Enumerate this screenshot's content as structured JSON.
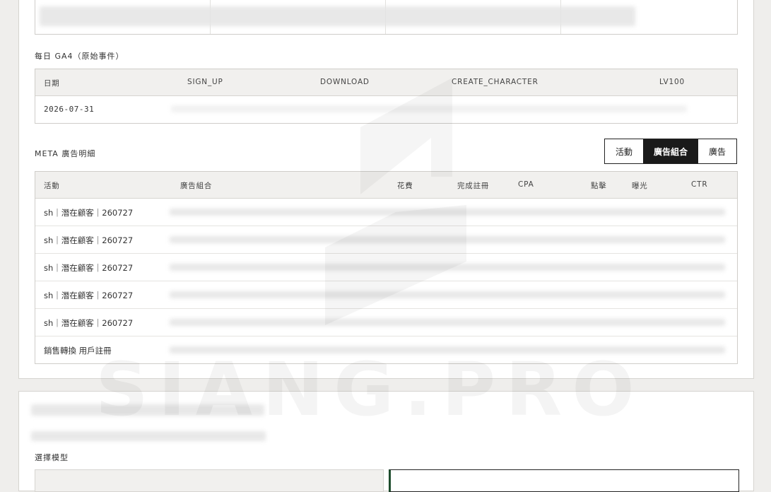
{
  "watermark": "SIANG.PRO",
  "ga4": {
    "title": "每日 GA4（原始事件）",
    "headers": [
      "日期",
      "SIGN_UP",
      "DOWNLOAD",
      "CREATE_CHARACTER",
      "LV100"
    ],
    "rows": [
      {
        "date": "2026-07-31"
      }
    ]
  },
  "meta": {
    "title": "META 廣告明細",
    "tabs": [
      "活動",
      "廣告組合",
      "廣告"
    ],
    "active_tab": "廣告組合",
    "headers": [
      "活動",
      "廣告組合",
      "花費",
      "完成註冊",
      "CPA",
      "點擊",
      "曝光",
      "CTR"
    ],
    "rows": [
      "sh｜潛在顧客｜260727",
      "sh｜潛在顧客｜260727",
      "sh｜潛在顧客｜260727",
      "sh｜潛在顧客｜260727",
      "sh｜潛在顧客｜260727",
      "銷售轉換 用戶註冊"
    ]
  },
  "model": {
    "label": "選擇模型"
  }
}
